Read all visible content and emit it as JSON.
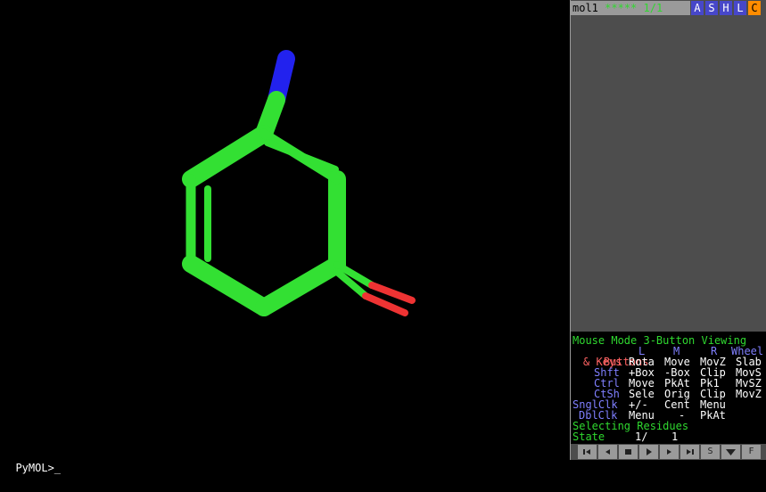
{
  "object_panel": {
    "name": "mol1",
    "state_info": "***** 1/1",
    "buttons": [
      "A",
      "S",
      "H",
      "L",
      "C"
    ],
    "button_colors": [
      "#4747c9",
      "#4747c9",
      "#4747c9",
      "#4747c9",
      "#ff8c00"
    ]
  },
  "mouse_mode": {
    "title": "Mouse Mode 3-Button Viewing",
    "buttons_header": [
      "Buttons",
      "L",
      "M",
      "R",
      "Wheel"
    ],
    "rows": [
      {
        "key": "& Keys",
        "L": "Rota",
        "M": "Move",
        "R": "MovZ",
        "Wheel": "Slab"
      },
      {
        "key": "Shft",
        "L": "+Box",
        "M": "-Box",
        "R": "Clip",
        "Wheel": "MovS"
      },
      {
        "key": "Ctrl",
        "L": "Move",
        "M": "PkAt",
        "R": "Pk1",
        "Wheel": "MvSZ"
      },
      {
        "key": "CtSh",
        "L": "Sele",
        "M": "Orig",
        "R": "Clip",
        "Wheel": "MovZ"
      },
      {
        "key": "SnglClk",
        "L": "+/-",
        "M": "Cent",
        "R": "Menu",
        "Wheel": ""
      },
      {
        "key": "DblClk",
        "L": "Menu",
        "M": "-",
        "R": "PkAt",
        "Wheel": ""
      }
    ],
    "selecting": "Selecting Residues",
    "state_label": "State",
    "state_value": "1/",
    "state_total": "1"
  },
  "command_line": {
    "prompt": "PyMOL>_",
    "value": ""
  },
  "playback": {
    "buttons": [
      "first-frame-icon",
      "prev-frame-icon",
      "stop-icon",
      "play-icon",
      "next-frame-icon",
      "last-frame-icon",
      "S",
      "scene-down-icon",
      "F"
    ]
  },
  "molecule": {
    "carbon_color": "#33e033",
    "nitrogen_color": "#2222ee",
    "oxygen_color": "#ee3333",
    "background": "#000000"
  }
}
